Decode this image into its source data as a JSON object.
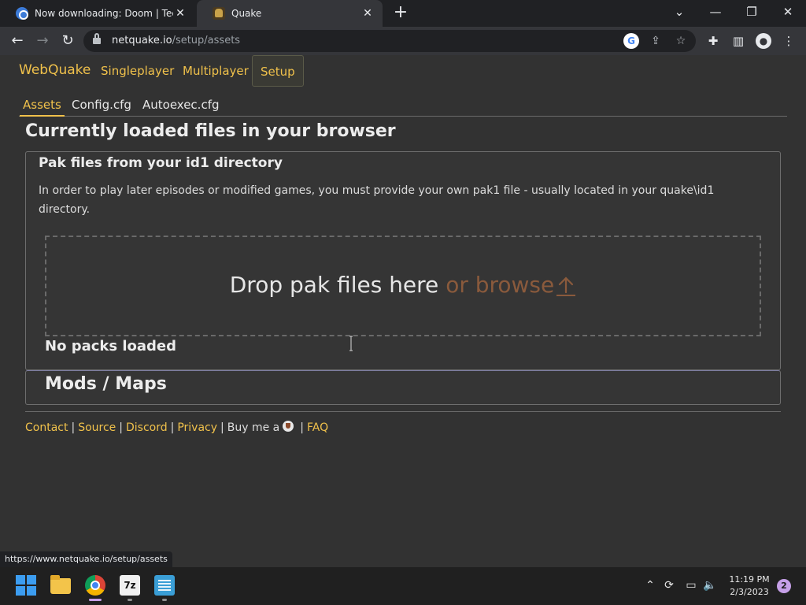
{
  "browser": {
    "tabs": [
      {
        "title": "Now downloading: Doom | TechS",
        "active": false
      },
      {
        "title": "Quake",
        "active": true
      }
    ],
    "new_tab_label": "+",
    "url_host": "netquake.io",
    "url_path": "/setup/assets",
    "status_url": "https://www.netquake.io/setup/assets"
  },
  "site": {
    "brand": "WebQuake",
    "nav": [
      "Singleplayer",
      "Multiplayer",
      "Setup"
    ],
    "active_nav": "Setup",
    "subtabs": [
      "Assets",
      "Config.cfg",
      "Autoexec.cfg"
    ],
    "active_subtab": "Assets",
    "page_title": "Currently loaded files in your browser",
    "pak_section": {
      "title": "Pak files from your id1 directory",
      "description": "In order to play later episodes or modified games, you must provide your own pak1 file - usually located in your quake\\id1 directory.",
      "drop_text": "Drop pak files here ",
      "browse_text": "or browse",
      "no_packs": "No packs loaded"
    },
    "mods_section": {
      "title": "Mods / Maps"
    },
    "footer": {
      "links": [
        "Contact",
        "Source",
        "Discord",
        "Privacy"
      ],
      "buy_me": "Buy me a",
      "faq": "FAQ",
      "separator": "|"
    }
  },
  "taskbar": {
    "time": "11:19 PM",
    "date": "2/3/2023",
    "notifications": "2",
    "sevenzip_label": "7z"
  },
  "colors": {
    "accent": "#f0c14b",
    "browse": "#8a5a3c",
    "background": "#323232"
  }
}
